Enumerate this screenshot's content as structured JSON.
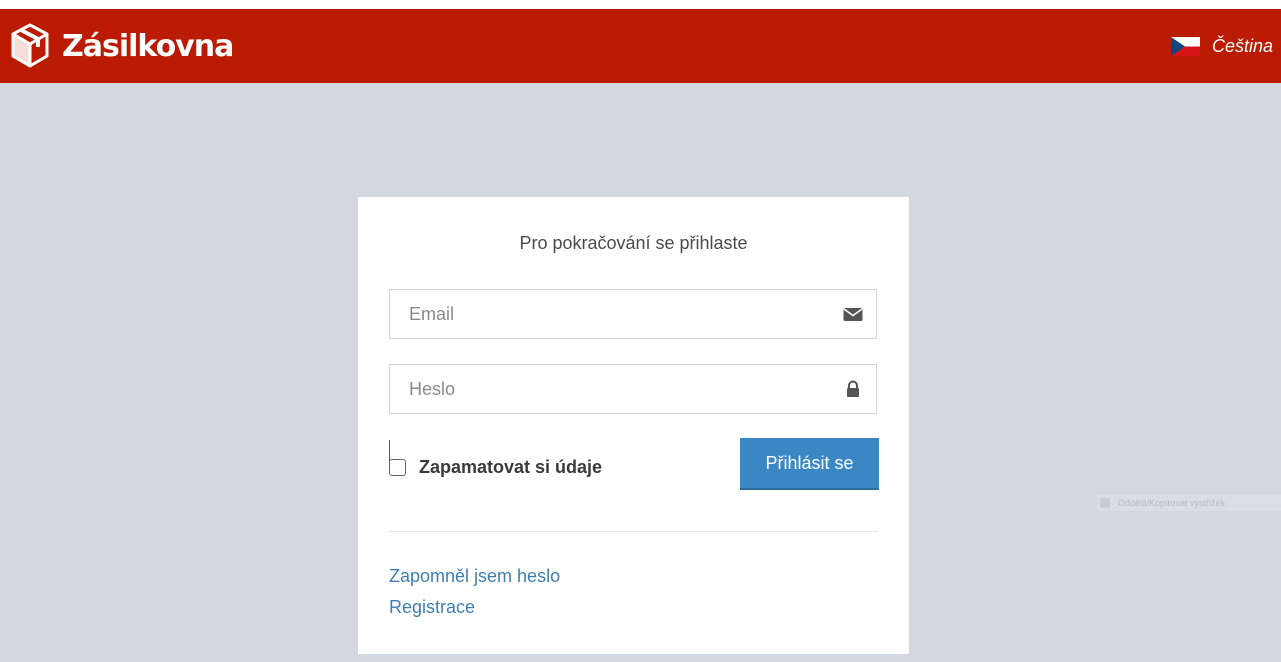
{
  "header": {
    "brand": "Zásilkovna",
    "language": "Čeština",
    "accent_color": "#ba1b02",
    "logo_icon": "package-icon",
    "flag_icon": "czech-flag-icon"
  },
  "login": {
    "title": "Pro pokračování se přihlaste",
    "email_placeholder": "Email",
    "email_icon": "envelope-icon",
    "password_placeholder": "Heslo",
    "password_icon": "lock-icon",
    "remember_label": "Zapamatovat si údaje",
    "remember_checked": false,
    "submit_label": "Přihlásit se",
    "submit_color": "#3b87c3"
  },
  "links": {
    "forgot_password": "Zapomněl jsem heslo",
    "register": "Registrace"
  },
  "overlay": {
    "label": "Oddělit/Kopírovat výstřižek"
  }
}
